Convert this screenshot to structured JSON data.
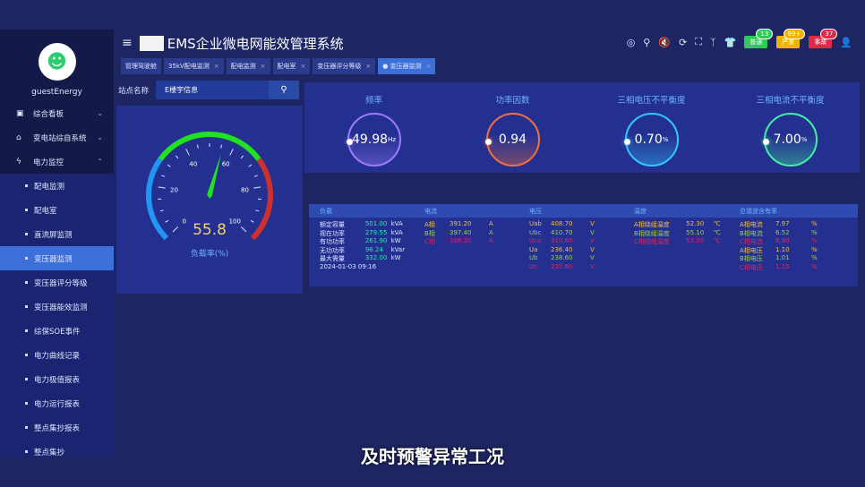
{
  "app": {
    "title": "EMS企业微电网能效管理系统",
    "user": "guestEnergy"
  },
  "header": {
    "alarms": [
      {
        "label": "普通",
        "count": "13",
        "color": "#2ecc55"
      },
      {
        "label": "严重",
        "count": "99+",
        "color": "#f0b400"
      },
      {
        "label": "事故",
        "count": "37",
        "color": "#e02848"
      }
    ]
  },
  "sidebar": {
    "groups": [
      {
        "label": "综合看板",
        "icon": "dashboard-icon",
        "open": false
      },
      {
        "label": "变电站综自系统",
        "icon": "home-icon",
        "open": false
      },
      {
        "label": "电力监控",
        "icon": "lightning-icon",
        "open": true
      }
    ],
    "items": [
      "配电监测",
      "配电室",
      "直流屏监测",
      "变压器监测",
      "变压器评分等级",
      "变压器能效监测",
      "综保SOE事件",
      "电力曲线记录",
      "电力极值报表",
      "电力运行报表",
      "整点集抄报表",
      "整点集抄"
    ],
    "active": "变压器监测"
  },
  "tabs": [
    {
      "label": "管理驾驶舱",
      "closable": false
    },
    {
      "label": "35kV配电监测",
      "closable": true
    },
    {
      "label": "配电监测",
      "closable": true
    },
    {
      "label": "配电室",
      "closable": true
    },
    {
      "label": "变压器评分等级",
      "closable": true
    },
    {
      "label": "● 变压器监测",
      "closable": true,
      "active": true
    }
  ],
  "search": {
    "label": "站点名称",
    "value": "E楼宇信息"
  },
  "gauge": {
    "value": "55.8",
    "label": "负载率(%)",
    "min": 0,
    "max": 100,
    "ticks": [
      "0",
      "20",
      "40",
      "60",
      "80",
      "100"
    ],
    "colors": [
      "#2196f3",
      "#22e022",
      "#d0302c"
    ]
  },
  "rings": [
    {
      "title": "频率",
      "value": "49.98",
      "unit": "Hz",
      "color": "#9b7bff"
    },
    {
      "title": "功率因数",
      "value": "0.94",
      "unit": "",
      "color": "#f07040"
    },
    {
      "title": "三相电压不平衡度",
      "value": "0.70",
      "unit": "%",
      "color": "#30c8ff"
    },
    {
      "title": "三相电流不平衡度",
      "value": "7.00",
      "unit": "%",
      "color": "#40f0a0"
    }
  ],
  "table": {
    "headers": [
      "负载",
      "电流",
      "电压",
      "温度",
      "总谐波含有率"
    ],
    "columns": [
      [
        [
          "额定容量",
          "501.00",
          "kVA",
          "#2ee6a8"
        ],
        [
          "视在功率",
          "279.55",
          "kVA",
          "#2ee6a8"
        ],
        [
          "有功功率",
          "261.90",
          "kW",
          "#2ee6a8"
        ],
        [
          "无功功率",
          "96.24",
          "kVar",
          "#2ee6a8"
        ],
        [
          "最大需量",
          "332.00",
          "kW",
          "#2ee6a8"
        ],
        [
          "2024-01-03 09:16",
          "",
          "",
          "#dfe6ff"
        ]
      ],
      [
        [
          "A相",
          "391.20",
          "A",
          "#f0c040"
        ],
        [
          "B相",
          "397.40",
          "A",
          "#9acd50"
        ],
        [
          "C相",
          "388.20",
          "A",
          "#e0245e"
        ]
      ],
      [
        [
          "Uab",
          "408.70",
          "V",
          "#f0c040"
        ],
        [
          "Ubc",
          "410.70",
          "V",
          "#9acd50"
        ],
        [
          "Uca",
          "410.60",
          "V",
          "#e0245e"
        ],
        [
          "Ua",
          "236.40",
          "V",
          "#f0c040"
        ],
        [
          "Ub",
          "238.60",
          "V",
          "#9acd50"
        ],
        [
          "Uc",
          "235.80",
          "V",
          "#e0245e"
        ]
      ],
      [
        [
          "A相绕组温度",
          "52.30",
          "℃",
          "#f0c040"
        ],
        [
          "B相绕组温度",
          "55.10",
          "℃",
          "#9acd50"
        ],
        [
          "C相绕组温度",
          "53.20",
          "℃",
          "#e0245e"
        ]
      ],
      [
        [
          "A相电流",
          "7.97",
          "%",
          "#f0c040"
        ],
        [
          "B相电流",
          "6.52",
          "%",
          "#9acd50"
        ],
        [
          "C相电流",
          "6.90",
          "%",
          "#e0245e"
        ],
        [
          "A相电压",
          "1.10",
          "%",
          "#f0c040"
        ],
        [
          "B相电压",
          "1.01",
          "%",
          "#9acd50"
        ],
        [
          "C相电压",
          "1.15",
          "%",
          "#e0245e"
        ]
      ]
    ]
  },
  "subtitle": "及时预警异常工况"
}
